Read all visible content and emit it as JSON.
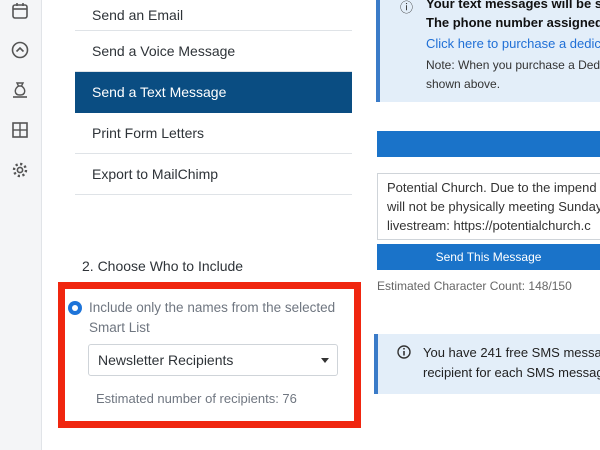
{
  "rail_icons": [
    "calendar-icon",
    "chevron-up-circle-icon",
    "money-bag-icon",
    "grid-icon",
    "gear-icon"
  ],
  "actions": {
    "items": [
      {
        "label": "Send an Email"
      },
      {
        "label": "Send a Voice Message"
      },
      {
        "label": "Send a Text Message",
        "active": true
      },
      {
        "label": "Print Form Letters"
      },
      {
        "label": "Export to MailChimp"
      }
    ]
  },
  "include": {
    "title": "2. Choose Who to Include",
    "radio_label": "Include only the names from the selected Smart List",
    "smart_list_selected": "Newsletter Recipients",
    "recipients": "Estimated number of recipients: 76"
  },
  "info_top": {
    "line1": "Your text messages will be sen",
    "line2": "The phone number assigned to",
    "link": "Click here to purchase a dedica",
    "note1": "Note: When you purchase a Dedic",
    "note2": "shown above."
  },
  "message": {
    "lines": [
      "Potential Church. Due to the impend",
      "will not be physically meeting Sunday",
      "livestream: https://potentialchurch.c"
    ],
    "send_label": "Send This Message",
    "char_count": "Estimated Character Count: 148/150"
  },
  "info_bottom": {
    "line1": "You have 241 free SMS messag",
    "line2": "recipient for each SMS message"
  },
  "colors": {
    "active_bg": "#0a4d82",
    "primary": "#1a73c9",
    "highlight": "#f0260f",
    "info_bg": "#e3eef9"
  }
}
